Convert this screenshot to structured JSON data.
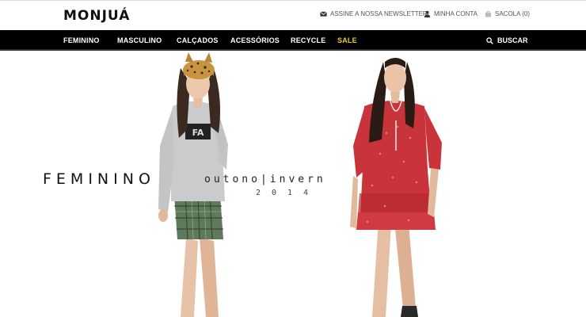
{
  "brand": {
    "logo_text": "MONJUÁ"
  },
  "utility": {
    "newsletter_label": "ASSINE A NOSSA NEWSLETTER!",
    "account_label": "MINHA CONTA",
    "bag_label": "SACOLA (0)"
  },
  "nav": {
    "items": [
      "FEMININO",
      "MASCULINO",
      "CALÇADOS",
      "ACESSÓRIOS",
      "RECYCLE",
      "SALE"
    ],
    "search_label": "BUSCAR"
  },
  "hero": {
    "title": "FEMININO",
    "season": "outono|invern",
    "year": "2014"
  },
  "colors": {
    "nav_bg": "#000000",
    "sale_accent": "#e8d21d"
  },
  "icons": [
    "envelope-icon",
    "user-icon",
    "bag-icon",
    "search-icon"
  ]
}
